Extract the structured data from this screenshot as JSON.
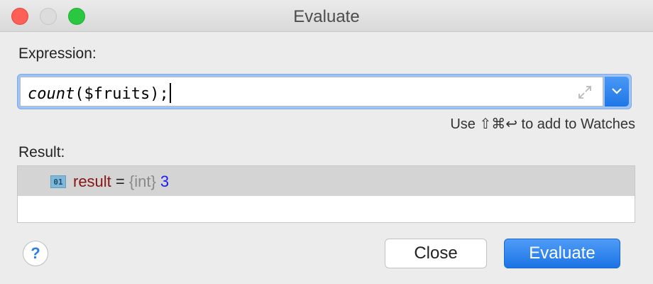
{
  "window": {
    "title": "Evaluate"
  },
  "expression": {
    "label": "Expression:",
    "function_part": "count",
    "rest_part": "($fruits);",
    "hint": "Use ⇧⌘↩ to add to Watches"
  },
  "result": {
    "label": "Result:",
    "type_badge": "01",
    "name": "result",
    "equals": " = ",
    "type": "{int}",
    "value": " 3"
  },
  "buttons": {
    "help": "?",
    "close": "Close",
    "evaluate": "Evaluate"
  },
  "colors": {
    "accent": "#1f76e6",
    "close_light": "#fe5f57",
    "max_light": "#2ac840"
  }
}
